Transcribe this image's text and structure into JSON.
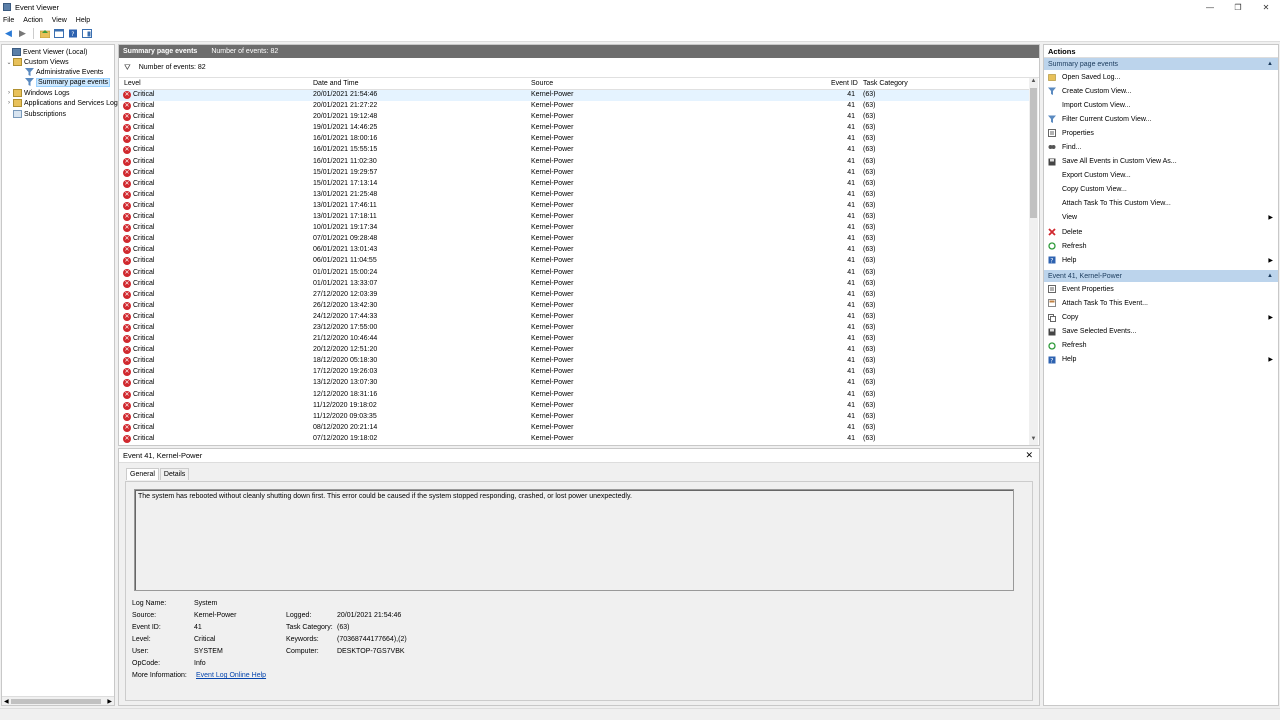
{
  "window": {
    "title": "Event Viewer"
  },
  "menu": [
    "File",
    "Action",
    "View",
    "Help"
  ],
  "tree": [
    {
      "label": "Event Viewer (Local)",
      "indent": 0,
      "exp": "",
      "icon": "computer-icon"
    },
    {
      "label": "Custom Views",
      "indent": 1,
      "exp": "⌄",
      "icon": "folder-icon"
    },
    {
      "label": "Administrative Events",
      "indent": 2,
      "exp": "",
      "icon": "filter-icon"
    },
    {
      "label": "Summary page events",
      "indent": 2,
      "exp": "",
      "icon": "filter-icon",
      "selected": true
    },
    {
      "label": "Windows Logs",
      "indent": 1,
      "exp": "›",
      "icon": "folder-icon"
    },
    {
      "label": "Applications and Services Logs",
      "indent": 1,
      "exp": "›",
      "icon": "folder-icon"
    },
    {
      "label": "Subscriptions",
      "indent": 1,
      "exp": "",
      "icon": "subscription-icon"
    }
  ],
  "center": {
    "header_title": "Summary page events",
    "header_count": "Number of events: 82",
    "filter_text": "Number of events: 82",
    "columns": [
      "Level",
      "Date and Time",
      "Source",
      "Event ID",
      "Task Category"
    ],
    "rows": [
      [
        "Critical",
        "20/01/2021 21:54:46",
        "Kernel-Power",
        "41",
        "(63)"
      ],
      [
        "Critical",
        "20/01/2021 21:27:22",
        "Kernel-Power",
        "41",
        "(63)"
      ],
      [
        "Critical",
        "20/01/2021 19:12:48",
        "Kernel-Power",
        "41",
        "(63)"
      ],
      [
        "Critical",
        "19/01/2021 14:46:25",
        "Kernel-Power",
        "41",
        "(63)"
      ],
      [
        "Critical",
        "16/01/2021 18:00:16",
        "Kernel-Power",
        "41",
        "(63)"
      ],
      [
        "Critical",
        "16/01/2021 15:55:15",
        "Kernel-Power",
        "41",
        "(63)"
      ],
      [
        "Critical",
        "16/01/2021 11:02:30",
        "Kernel-Power",
        "41",
        "(63)"
      ],
      [
        "Critical",
        "15/01/2021 19:29:57",
        "Kernel-Power",
        "41",
        "(63)"
      ],
      [
        "Critical",
        "15/01/2021 17:13:14",
        "Kernel-Power",
        "41",
        "(63)"
      ],
      [
        "Critical",
        "13/01/2021 21:25:48",
        "Kernel-Power",
        "41",
        "(63)"
      ],
      [
        "Critical",
        "13/01/2021 17:46:11",
        "Kernel-Power",
        "41",
        "(63)"
      ],
      [
        "Critical",
        "13/01/2021 17:18:11",
        "Kernel-Power",
        "41",
        "(63)"
      ],
      [
        "Critical",
        "10/01/2021 19:17:34",
        "Kernel-Power",
        "41",
        "(63)"
      ],
      [
        "Critical",
        "07/01/2021 09:28:48",
        "Kernel-Power",
        "41",
        "(63)"
      ],
      [
        "Critical",
        "06/01/2021 13:01:43",
        "Kernel-Power",
        "41",
        "(63)"
      ],
      [
        "Critical",
        "06/01/2021 11:04:55",
        "Kernel-Power",
        "41",
        "(63)"
      ],
      [
        "Critical",
        "01/01/2021 15:00:24",
        "Kernel-Power",
        "41",
        "(63)"
      ],
      [
        "Critical",
        "01/01/2021 13:33:07",
        "Kernel-Power",
        "41",
        "(63)"
      ],
      [
        "Critical",
        "27/12/2020 12:03:39",
        "Kernel-Power",
        "41",
        "(63)"
      ],
      [
        "Critical",
        "26/12/2020 13:42:30",
        "Kernel-Power",
        "41",
        "(63)"
      ],
      [
        "Critical",
        "24/12/2020 17:44:33",
        "Kernel-Power",
        "41",
        "(63)"
      ],
      [
        "Critical",
        "23/12/2020 17:55:00",
        "Kernel-Power",
        "41",
        "(63)"
      ],
      [
        "Critical",
        "21/12/2020 10:46:44",
        "Kernel-Power",
        "41",
        "(63)"
      ],
      [
        "Critical",
        "20/12/2020 12:51:20",
        "Kernel-Power",
        "41",
        "(63)"
      ],
      [
        "Critical",
        "18/12/2020 05:18:30",
        "Kernel-Power",
        "41",
        "(63)"
      ],
      [
        "Critical",
        "17/12/2020 19:26:03",
        "Kernel-Power",
        "41",
        "(63)"
      ],
      [
        "Critical",
        "13/12/2020 13:07:30",
        "Kernel-Power",
        "41",
        "(63)"
      ],
      [
        "Critical",
        "12/12/2020 18:31:16",
        "Kernel-Power",
        "41",
        "(63)"
      ],
      [
        "Critical",
        "11/12/2020 19:18:02",
        "Kernel-Power",
        "41",
        "(63)"
      ],
      [
        "Critical",
        "11/12/2020 09:03:35",
        "Kernel-Power",
        "41",
        "(63)"
      ],
      [
        "Critical",
        "08/12/2020 20:21:14",
        "Kernel-Power",
        "41",
        "(63)"
      ],
      [
        "Critical",
        "07/12/2020 19:18:02",
        "Kernel-Power",
        "41",
        "(63)"
      ]
    ]
  },
  "detail": {
    "title": "Event 41, Kernel-Power",
    "tabs": [
      "General",
      "Details"
    ],
    "message": "The system has rebooted without cleanly shutting down first. This error could be caused if the system stopped responding, crashed, or lost power unexpectedly.",
    "props_left": [
      {
        "label": "Log Name:",
        "value": "System"
      },
      {
        "label": "Source:",
        "value": "Kernel-Power"
      },
      {
        "label": "Event ID:",
        "value": "41"
      },
      {
        "label": "Level:",
        "value": "Critical"
      },
      {
        "label": "User:",
        "value": "SYSTEM"
      },
      {
        "label": "OpCode:",
        "value": "Info"
      }
    ],
    "props_right": [
      {
        "label": "Logged:",
        "value": "20/01/2021 21:54:46"
      },
      {
        "label": "Task Category:",
        "value": "(63)"
      },
      {
        "label": "Keywords:",
        "value": "(70368744177664),(2)"
      },
      {
        "label": "Computer:",
        "value": "DESKTOP-7GS7VBK"
      }
    ],
    "more_info_label": "More Information:",
    "more_info_link": "Event Log Online Help"
  },
  "actions": {
    "title": "Actions",
    "sections": [
      {
        "title": "Summary page events",
        "items": [
          {
            "label": "Open Saved Log...",
            "icon": "open-log-icon"
          },
          {
            "label": "Create Custom View...",
            "icon": "filter-icon"
          },
          {
            "label": "Import Custom View...",
            "icon": ""
          },
          {
            "label": "Filter Current Custom View...",
            "icon": "filter-icon"
          },
          {
            "label": "Properties",
            "icon": "properties-icon"
          },
          {
            "label": "Find...",
            "icon": "find-icon"
          },
          {
            "label": "Save All Events in Custom View As...",
            "icon": "save-icon"
          },
          {
            "label": "Export Custom View...",
            "icon": ""
          },
          {
            "label": "Copy Custom View...",
            "icon": ""
          },
          {
            "label": "Attach Task To This Custom View...",
            "icon": ""
          },
          {
            "label": "View",
            "icon": "",
            "submenu": true
          },
          {
            "label": "Delete",
            "icon": "delete-icon"
          },
          {
            "label": "Refresh",
            "icon": "refresh-icon"
          },
          {
            "label": "Help",
            "icon": "help-icon",
            "submenu": true
          }
        ]
      },
      {
        "title": "Event 41, Kernel-Power",
        "items": [
          {
            "label": "Event Properties",
            "icon": "properties-icon"
          },
          {
            "label": "Attach Task To This Event...",
            "icon": "task-icon"
          },
          {
            "label": "Copy",
            "icon": "copy-icon",
            "submenu": true
          },
          {
            "label": "Save Selected Events...",
            "icon": "save-icon"
          },
          {
            "label": "Refresh",
            "icon": "refresh-icon"
          },
          {
            "label": "Help",
            "icon": "help-icon",
            "submenu": true
          }
        ]
      }
    ]
  },
  "colors": {
    "critical": "#d0282e",
    "section_bg": "#bcd4ec",
    "header_bg": "#6d6d6d",
    "link": "#0645ad"
  }
}
